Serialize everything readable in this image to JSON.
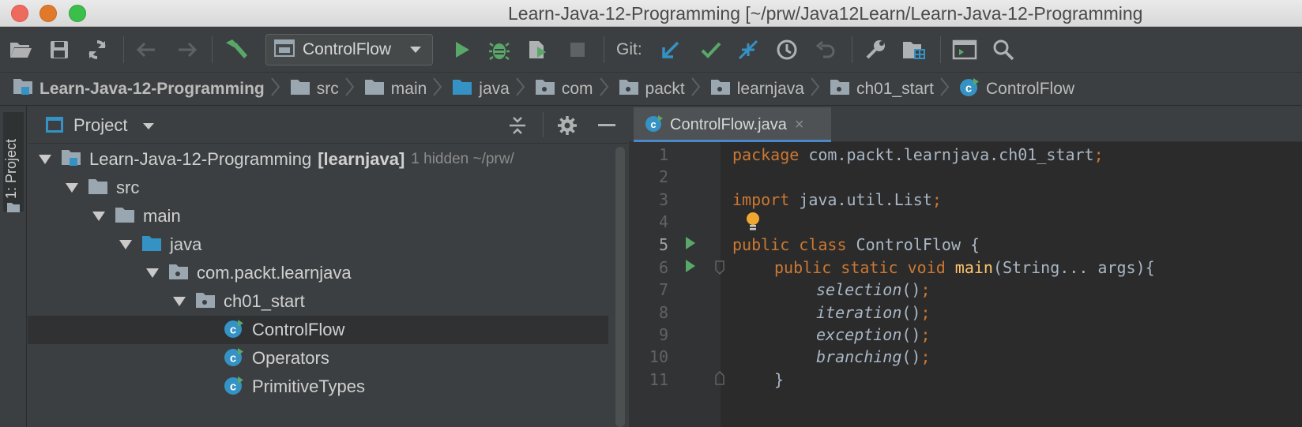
{
  "window": {
    "title": "Learn-Java-12-Programming [~/prw/Java12Learn/Learn-Java-12-Programming"
  },
  "toolbar": {
    "run_config": "ControlFlow",
    "git_label": "Git:"
  },
  "breadcrumb": [
    {
      "label": "Learn-Java-12-Programming",
      "icon": "module-folder-icon"
    },
    {
      "label": "src",
      "icon": "folder-icon"
    },
    {
      "label": "main",
      "icon": "folder-icon"
    },
    {
      "label": "java",
      "icon": "source-folder-icon"
    },
    {
      "label": "com",
      "icon": "package-icon"
    },
    {
      "label": "packt",
      "icon": "package-icon"
    },
    {
      "label": "learnjava",
      "icon": "package-icon"
    },
    {
      "label": "ch01_start",
      "icon": "package-icon"
    },
    {
      "label": "ControlFlow",
      "icon": "java-class-icon"
    }
  ],
  "stripe": {
    "project_tab": "1: Project"
  },
  "project_panel": {
    "title": "Project",
    "tree": [
      {
        "label": "Learn-Java-12-Programming",
        "bold_suffix": "[learnjava]",
        "hint": "1 hidden  ~/prw/",
        "icon": "module-folder-icon"
      },
      {
        "label": "src",
        "icon": "folder-icon"
      },
      {
        "label": "main",
        "icon": "folder-icon"
      },
      {
        "label": "java",
        "icon": "source-folder-icon"
      },
      {
        "label": "com.packt.learnjava",
        "icon": "package-icon"
      },
      {
        "label": "ch01_start",
        "icon": "package-icon"
      },
      {
        "label": "ControlFlow",
        "icon": "java-class-icon",
        "selected": true
      },
      {
        "label": "Operators",
        "icon": "java-class-icon"
      },
      {
        "label": "PrimitiveTypes",
        "icon": "java-class-icon"
      }
    ]
  },
  "editor": {
    "tab_name": "ControlFlow.java",
    "tab_close": "×",
    "line_numbers": [
      "1",
      "2",
      "3",
      "4",
      "5",
      "6",
      "7",
      "8",
      "9",
      "10",
      "11"
    ],
    "lines": {
      "l1_kw": "package",
      "l1_rest": " com.packt.learnjava.ch01_start",
      "l1_semi": ";",
      "l3_kw": "import",
      "l3_rest": " java.util.List",
      "l3_semi": ";",
      "l5_kw": "public class",
      "l5_rest": " ControlFlow {",
      "l6_kw": "public static void",
      "l6_fn": " main",
      "l6_rest": "(String... args){",
      "l7_call": "selection",
      "l8_call": "iteration",
      "l9_call": "exception",
      "l10_call": "branching",
      "call_suffix": "()",
      "semi": ";",
      "l11": "}"
    }
  },
  "colors": {
    "keyword": "#cc7832",
    "method": "#ffc66d",
    "text": "#a9b7c6",
    "run_green": "#59a869",
    "accent_blue": "#4a88c7"
  }
}
